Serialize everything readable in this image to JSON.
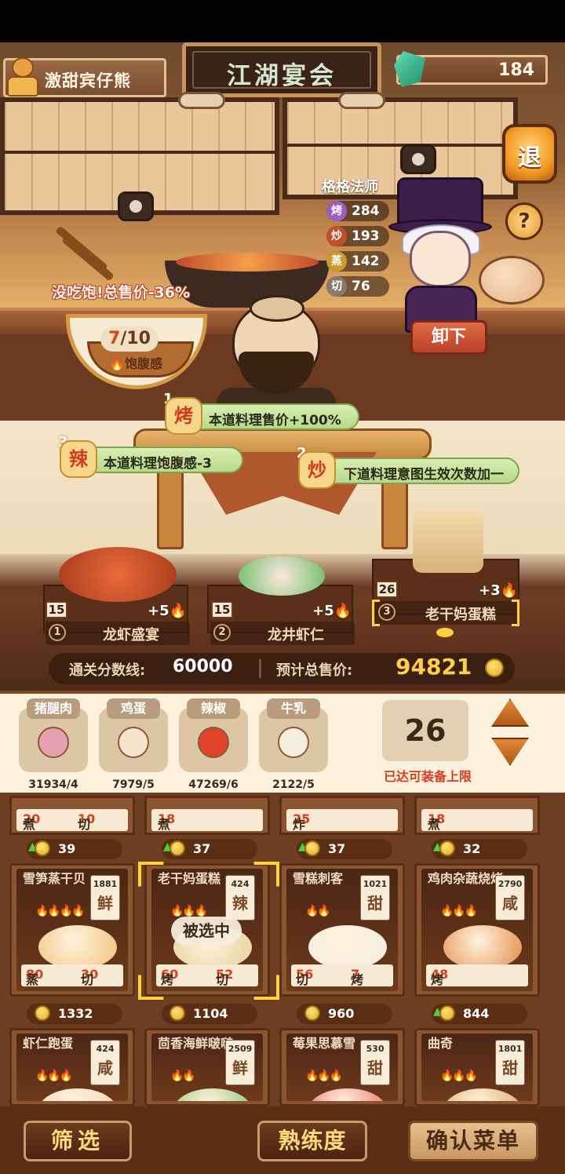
{
  "player": {
    "name": "激甜宾仔熊"
  },
  "title": "江湖宴会",
  "currency": {
    "gems": "184",
    "icon": "gem-icon"
  },
  "buttons": {
    "exit": "退",
    "help": "?",
    "unload": "卸下"
  },
  "chef": {
    "name": "格格法师",
    "stats": [
      {
        "skill": "烤",
        "value": "284",
        "color": "#9b5fc0"
      },
      {
        "skill": "炒",
        "value": "193",
        "color": "#c0502a"
      },
      {
        "skill": "蒸",
        "value": "142",
        "color": "#c99a2a"
      },
      {
        "skill": "切",
        "value": "76",
        "color": "#8a7a6a"
      }
    ]
  },
  "satiety": {
    "warning": "没吃饱!总售价-36%",
    "current": "7",
    "total": "/10",
    "label": "饱腹感"
  },
  "effects": [
    {
      "num": "1",
      "badge": "烤",
      "text": "本道料理售价+100%"
    },
    {
      "num": "3",
      "badge": "辣",
      "text": "本道料理饱腹感-3"
    },
    {
      "num": "2",
      "badge": "炒",
      "text": "下道料理意图生效次数加一"
    }
  ],
  "served_dishes": [
    {
      "index": "1",
      "name": "龙虾盛宴",
      "level": "15",
      "bonus": "+5"
    },
    {
      "index": "2",
      "name": "龙井虾仁",
      "level": "15",
      "bonus": "+5"
    },
    {
      "index": "3",
      "name": "老干妈蛋糕",
      "level": "26",
      "bonus": "+3"
    }
  ],
  "score": {
    "pass_label": "通关分数线:",
    "pass_value": "60000",
    "total_label": "预计总售价:",
    "total_value": "94821"
  },
  "ingredients": [
    {
      "name": "猪腿肉",
      "count": "31934/4",
      "color": "#e8a0b0"
    },
    {
      "name": "鸡蛋",
      "count": "7979/5",
      "color": "#f6e4cc"
    },
    {
      "name": "辣椒",
      "count": "47269/6",
      "color": "#e2412a"
    },
    {
      "name": "牛乳",
      "count": "2122/5",
      "color": "#f4eee0"
    }
  ],
  "capacity": {
    "value": "26",
    "text": "已达可装备上限"
  },
  "top_row": [
    {
      "s1": "煮",
      "v1": "20",
      "s2": "切",
      "v2": "10",
      "price": "39",
      "up": true
    },
    {
      "s1": "煮",
      "v1": "18",
      "s2": "",
      "v2": "",
      "price": "37",
      "up": true
    },
    {
      "s1": "炸",
      "v1": "25",
      "s2": "",
      "v2": "",
      "price": "37",
      "up": true
    },
    {
      "s1": "煮",
      "v1": "18",
      "s2": "",
      "v2": "",
      "price": "32",
      "up": true
    }
  ],
  "recipes_row1": [
    {
      "name": "雪笋蒸干贝",
      "count": "1881",
      "flavor": "鲜",
      "fires": "🔥🔥🔥🔥",
      "s1": "蒸",
      "v1": "80",
      "s2": "切",
      "v2": "30",
      "price": "1332",
      "up": false,
      "food": "#f1c27a"
    },
    {
      "name": "老干妈蛋糕",
      "count": "424",
      "flavor": "辣",
      "fires": "🔥🔥🔥",
      "s1": "烤",
      "v1": "60",
      "s2": "切",
      "v2": "52",
      "price": "1104",
      "up": false,
      "food": "#e7cf9a",
      "selected_label": "被选中"
    },
    {
      "name": "雪糕刺客",
      "count": "1021",
      "flavor": "甜",
      "fires": "🔥🔥",
      "s1": "切",
      "v1": "56",
      "s2": "烤",
      "v2": "7",
      "price": "960",
      "up": false,
      "food": "#f4ece0"
    },
    {
      "name": "鸡肉杂蔬烧烤",
      "count": "2790",
      "flavor": "咸",
      "fires": "🔥🔥🔥",
      "s1": "烤",
      "v1": "48",
      "s2": "",
      "v2": "",
      "price": "844",
      "up": true,
      "food": "#e28a4a"
    }
  ],
  "recipes_row2": [
    {
      "name": "虾仁跑蛋",
      "count": "424",
      "flavor": "咸",
      "fires": "🔥🔥🔥",
      "food": "#f4d0b4"
    },
    {
      "name": "茴香海鲜啵啵",
      "count": "2509",
      "flavor": "鲜",
      "fires": "🔥🔥",
      "food": "#8ac07a"
    },
    {
      "name": "莓果思慕雪",
      "count": "530",
      "flavor": "甜",
      "fires": "🔥🔥🔥",
      "food": "#e56a6a"
    },
    {
      "name": "曲奇",
      "count": "1801",
      "flavor": "甜",
      "fires": "🔥🔥🔥",
      "food": "#d8a46a"
    }
  ],
  "bottom": {
    "filter": "筛选",
    "proficiency": "熟练度",
    "confirm": "确认菜单"
  }
}
